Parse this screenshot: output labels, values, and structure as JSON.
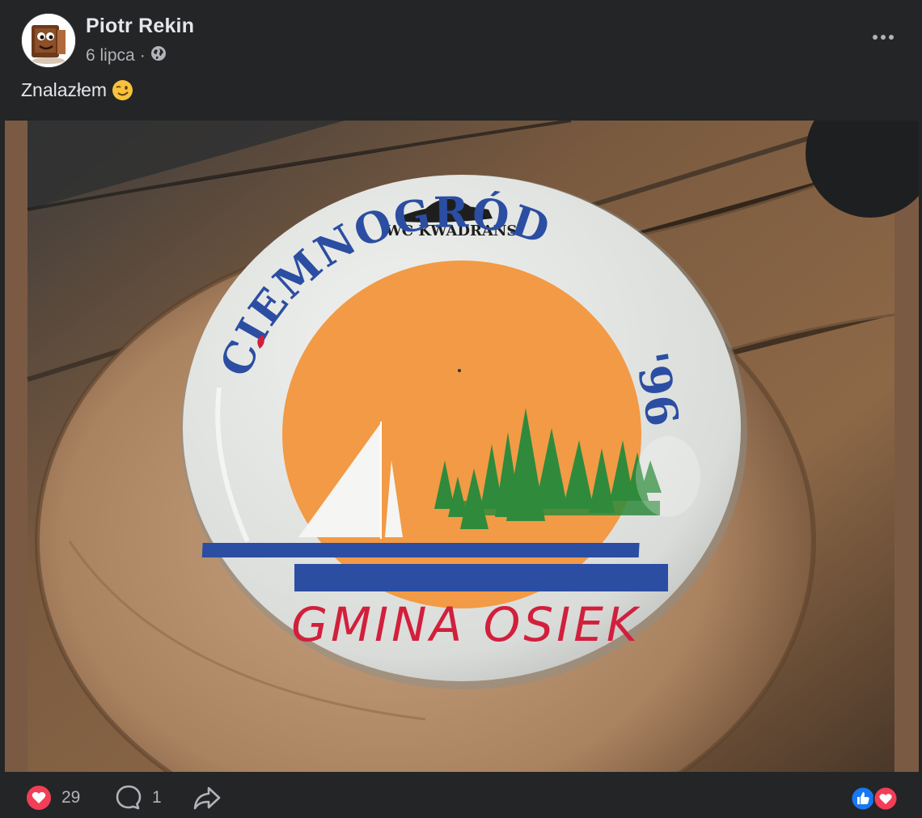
{
  "post": {
    "author": "Piotr Rekin",
    "date": "6 lipca",
    "separator": "·",
    "privacy_icon": "globe-icon",
    "text": "Znalazłem",
    "emoji": "winking-face-emoji"
  },
  "image": {
    "badge": {
      "top_text": "WC KWADRANS",
      "title": "CIEMNOGRÓD",
      "year": "'96",
      "bottom_text": "GMINA OSIEK"
    }
  },
  "actions": {
    "like_count": "29",
    "comment_count": "1",
    "like_icon": "heart-icon",
    "comment_icon": "comment-bubble-icon",
    "share_icon": "share-arrow-icon",
    "reactions": [
      "thumbs-up-icon",
      "heart-icon"
    ]
  },
  "colors": {
    "background": "#242526",
    "text": "#e4e6eb",
    "muted": "#b0b3b8",
    "heart": "#f33e58",
    "like_blue": "#1877f2",
    "badge_blue": "#2b4ea2",
    "badge_orange": "#f29a45",
    "badge_red": "#d21f3c",
    "tree_green": "#2f8a3c"
  }
}
